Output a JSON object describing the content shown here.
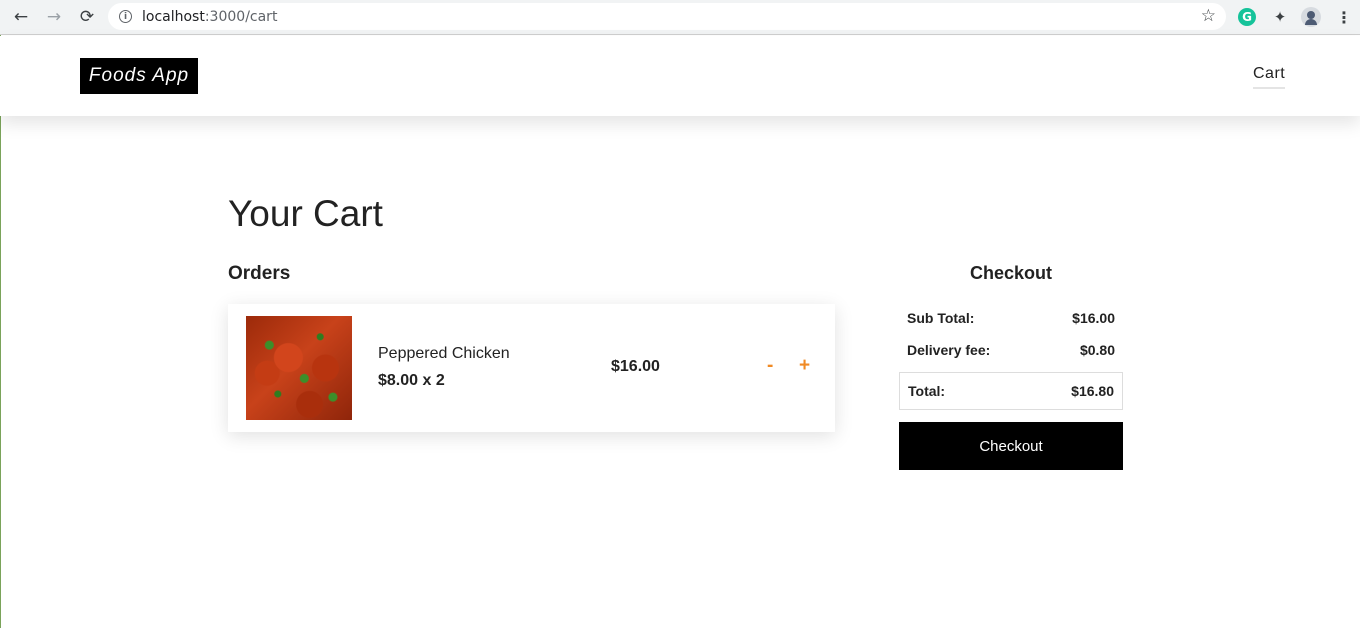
{
  "browser": {
    "url_host": "localhost",
    "url_path": ":3000/cart",
    "icons": [
      "back-arrow-icon",
      "forward-arrow-icon",
      "reload-icon",
      "info-icon",
      "star-icon",
      "grammarly-icon",
      "extensions-puzzle-icon",
      "profile-icon",
      "more-menu-icon"
    ]
  },
  "header": {
    "logo": "Foods App",
    "nav_cart": "Cart"
  },
  "page": {
    "title": "Your Cart",
    "orders_heading": "Orders"
  },
  "orders": [
    {
      "name": "Peppered Chicken",
      "price_qty": "$8.00 x 2",
      "total": "$16.00",
      "decrement": "-",
      "increment": "+"
    }
  ],
  "checkout": {
    "heading": "Checkout",
    "subtotal_label": "Sub Total:",
    "subtotal_value": "$16.00",
    "delivery_label": "Delivery fee:",
    "delivery_value": "$0.80",
    "total_label": "Total:",
    "total_value": "$16.80",
    "button": "Checkout"
  },
  "colors": {
    "accent": "#f08a24",
    "logo_bg": "#000000",
    "button_bg": "#000000"
  }
}
